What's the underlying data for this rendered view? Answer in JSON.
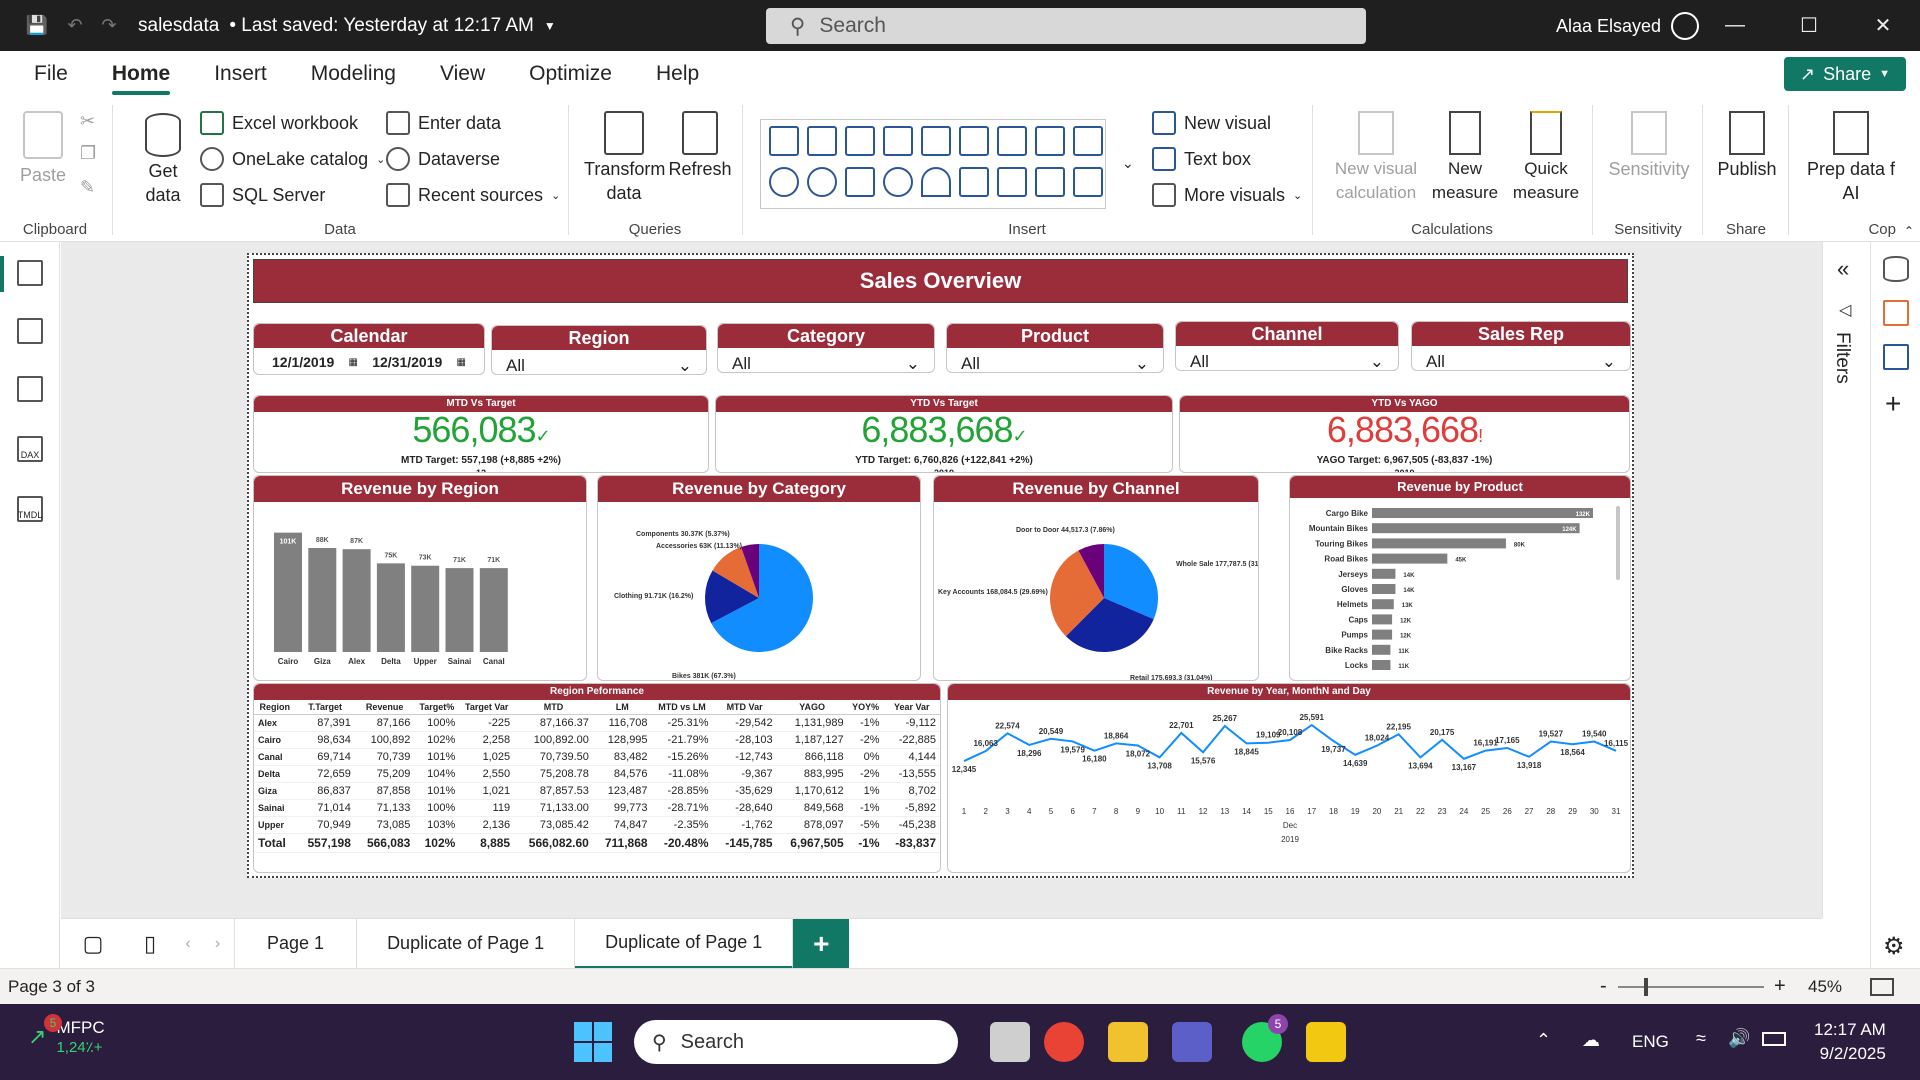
{
  "window": {
    "doc_name": "salesdata",
    "save_status": "• Last saved: Yesterday at 12:17 AM",
    "search_placeholder": "Search",
    "user_name": "Alaa Elsayed"
  },
  "menu": [
    "File",
    "Home",
    "Insert",
    "Modeling",
    "View",
    "Optimize",
    "Help"
  ],
  "share_label": "Share",
  "ribbon": {
    "clipboard": {
      "paste": "Paste",
      "label": "Clipboard"
    },
    "data": {
      "get_data": "Get data",
      "items": [
        "Excel workbook",
        "OneLake catalog",
        "SQL Server",
        "Enter data",
        "Dataverse",
        "Recent sources"
      ],
      "label": "Data"
    },
    "queries": {
      "transform": "Transform data",
      "refresh": "Refresh",
      "label": "Queries"
    },
    "insert": {
      "new_visual": "New visual",
      "text_box": "Text box",
      "more_visuals": "More visuals",
      "label": "Insert"
    },
    "calculations": {
      "new_visual_calc": "New visual calculation",
      "new_measure": "New measure",
      "quick_measure": "Quick measure",
      "label": "Calculations"
    },
    "sensitivity": {
      "btn": "Sensitivity",
      "label": "Sensitivity"
    },
    "share": {
      "publish": "Publish",
      "label": "Share"
    },
    "copilot": {
      "prep": "Prep data f AI",
      "label": "Cop"
    }
  },
  "report": {
    "title": "Sales Overview",
    "slicers": [
      {
        "title": "Calendar",
        "value": "12/1/2019",
        "value2": "12/31/2019"
      },
      {
        "title": "Region",
        "value": "All"
      },
      {
        "title": "Category",
        "value": "All"
      },
      {
        "title": "Product",
        "value": "All"
      },
      {
        "title": "Channel",
        "value": "All"
      },
      {
        "title": "Sales Rep",
        "value": "All"
      }
    ],
    "kpis": [
      {
        "title": "MTD Vs Target",
        "value": "566,083",
        "mark": "✓",
        "target": "MTD Target: 557,198 (+8,885 +2%)",
        "foot": "12",
        "color": "#21a336"
      },
      {
        "title": "YTD Vs Target",
        "value": "6,883,668",
        "mark": "✓",
        "target": "YTD Target: 6,760,826 (+122,841 +2%)",
        "foot": "2019",
        "color": "#21a336"
      },
      {
        "title": "YTD Vs YAGO",
        "value": "6,883,668",
        "mark": "!",
        "target": "YAGO Target: 6,967,505 (-83,837 -1%)",
        "foot": "2019",
        "color": "#e03c3c"
      }
    ],
    "region_chart": {
      "title": "Revenue by Region"
    },
    "category_chart": {
      "title": "Revenue by Category"
    },
    "channel_chart": {
      "title": "Revenue by Channel"
    },
    "product_chart": {
      "title": "Revenue by Product"
    },
    "table": {
      "title": "Region Peformance",
      "columns": [
        "Region",
        "T.Target",
        "Revenue",
        "Target%",
        "Target Var",
        "MTD",
        "LM",
        "MTD vs LM",
        "MTD Var",
        "YAGO",
        "YOY%",
        "Year Var"
      ],
      "rows": [
        [
          "Alex",
          "87,391",
          "87,166",
          "100%",
          "-225",
          "87,166.37",
          "116,708",
          "-25.31%",
          "-29,542",
          "1,131,989",
          "-1%",
          "-9,112"
        ],
        [
          "Cairo",
          "98,634",
          "100,892",
          "102%",
          "2,258",
          "100,892.00",
          "128,995",
          "-21.79%",
          "-28,103",
          "1,187,127",
          "-2%",
          "-22,885"
        ],
        [
          "Canal",
          "69,714",
          "70,739",
          "101%",
          "1,025",
          "70,739.50",
          "83,482",
          "-15.26%",
          "-12,743",
          "866,118",
          "0%",
          "4,144"
        ],
        [
          "Delta",
          "72,659",
          "75,209",
          "104%",
          "2,550",
          "75,208.78",
          "84,576",
          "-11.08%",
          "-9,367",
          "883,995",
          "-2%",
          "-13,555"
        ],
        [
          "Giza",
          "86,837",
          "87,858",
          "101%",
          "1,021",
          "87,857.53",
          "123,487",
          "-28.85%",
          "-35,629",
          "1,170,612",
          "1%",
          "8,702"
        ],
        [
          "Sainai",
          "71,014",
          "71,133",
          "100%",
          "119",
          "71,133.00",
          "99,773",
          "-28.71%",
          "-28,640",
          "849,568",
          "-1%",
          "-5,892"
        ],
        [
          "Upper",
          "70,949",
          "73,085",
          "103%",
          "2,136",
          "73,085.42",
          "74,847",
          "-2.35%",
          "-1,762",
          "878,097",
          "-5%",
          "-45,238"
        ]
      ],
      "total": [
        "Total",
        "557,198",
        "566,083",
        "102%",
        "8,885",
        "566,082.60",
        "711,868",
        "-20.48%",
        "-145,785",
        "6,967,505",
        "-1%",
        "-83,837"
      ]
    },
    "line_chart": {
      "title": "Revenue by Year, MonthN and Day",
      "xlabel_month": "Dec",
      "xlabel_year": "2019"
    }
  },
  "chart_data": [
    {
      "type": "bar",
      "title": "Revenue by Region",
      "categories": [
        "Cairo",
        "Giza",
        "Alex",
        "Delta",
        "Upper",
        "Sainai",
        "Canal"
      ],
      "values": [
        101,
        88,
        87,
        75,
        73,
        71,
        71
      ],
      "labels": [
        "101K",
        "88K",
        "87K",
        "75K",
        "73K",
        "71K",
        "71K"
      ],
      "color": "#808080"
    },
    {
      "type": "pie",
      "title": "Revenue by Category",
      "series": [
        {
          "name": "Bikes",
          "label": "Bikes 381K (67.3%)",
          "value": 67.3,
          "color": "#118dff"
        },
        {
          "name": "Clothing",
          "label": "Clothing 91.71K (16.2%)",
          "value": 16.2,
          "color": "#12239e"
        },
        {
          "name": "Accessories",
          "label": "Accessories 63K (11.13%)",
          "value": 11.13,
          "color": "#e66c37"
        },
        {
          "name": "Components",
          "label": "Components 30.37K (5.37%)",
          "value": 5.37,
          "color": "#6b007b"
        }
      ]
    },
    {
      "type": "pie",
      "title": "Revenue by Channel",
      "series": [
        {
          "name": "Whole Sale",
          "label": "Whole Sale 177,787.5 (31.41%)",
          "value": 31.41,
          "color": "#118dff"
        },
        {
          "name": "Retail",
          "label": "Retail 175,693.3 (31.04%)",
          "value": 31.04,
          "color": "#12239e"
        },
        {
          "name": "Key Accounts",
          "label": "Key Accounts 168,084.5 (29.69%)",
          "value": 29.69,
          "color": "#e66c37"
        },
        {
          "name": "Door to Door",
          "label": "Door to Door 44,517.3 (7.86%)",
          "value": 7.86,
          "color": "#6b007b"
        }
      ]
    },
    {
      "type": "bar",
      "title": "Revenue by Product",
      "orientation": "horizontal",
      "categories": [
        "Cargo Bike",
        "Mountain Bikes",
        "Touring Bikes",
        "Road Bikes",
        "Jerseys",
        "Gloves",
        "Helmets",
        "Caps",
        "Pumps",
        "Bike Racks",
        "Locks"
      ],
      "values": [
        132,
        124,
        80,
        45,
        14,
        14,
        13,
        12,
        12,
        11,
        11
      ],
      "labels": [
        "132K",
        "124K",
        "80K",
        "45K",
        "14K",
        "14K",
        "13K",
        "12K",
        "12K",
        "11K",
        "11K"
      ],
      "color": "#808080"
    },
    {
      "type": "line",
      "title": "Revenue by Year, MonthN and Day",
      "x": [
        1,
        2,
        3,
        4,
        5,
        6,
        7,
        8,
        9,
        10,
        11,
        12,
        13,
        14,
        15,
        16,
        17,
        18,
        19,
        20,
        21,
        22,
        23,
        24,
        25,
        26,
        27,
        28,
        29,
        30,
        31
      ],
      "values": [
        12345,
        16063,
        22574,
        18296,
        20549,
        19579,
        16180,
        18864,
        18072,
        13708,
        22701,
        15576,
        25267,
        18845,
        19109,
        20108,
        25591,
        19737,
        14639,
        18024,
        22195,
        13694,
        20175,
        13167,
        16191,
        17165,
        13918,
        19527,
        18564,
        19540,
        16115
      ],
      "labels": [
        "12,345",
        "16,063",
        "22,574",
        "18,296",
        "20,549",
        "19,579",
        "16,180",
        "18,864",
        "18,072",
        "13,708",
        "22,701",
        "15,576",
        "25,267",
        "18,845",
        "19,109",
        "20,108",
        "25,591",
        "19,737",
        "14,639",
        "18,024",
        "22,195",
        "13,694",
        "20,175",
        "13,167",
        "16,191",
        "17,165",
        "13,918",
        "19,527",
        "18,564",
        "19,540",
        "16,115"
      ],
      "xlabel": "Dec",
      "xlabel2": "2019",
      "color": "#118dff"
    }
  ],
  "pages": [
    "Page 1",
    "Duplicate of Page 1",
    "Duplicate of Page 1"
  ],
  "status": {
    "page": "Page 3 of 3",
    "zoom": "45%"
  },
  "side": {
    "filters": "Filters"
  },
  "taskbar": {
    "widget_title": "MFPC",
    "widget_value": "1,24٪+",
    "widget_badge": "5",
    "search": "Search",
    "lang": "ENG",
    "time": "12:17 AM",
    "date": "9/2/2025",
    "teams_badge": "5"
  }
}
